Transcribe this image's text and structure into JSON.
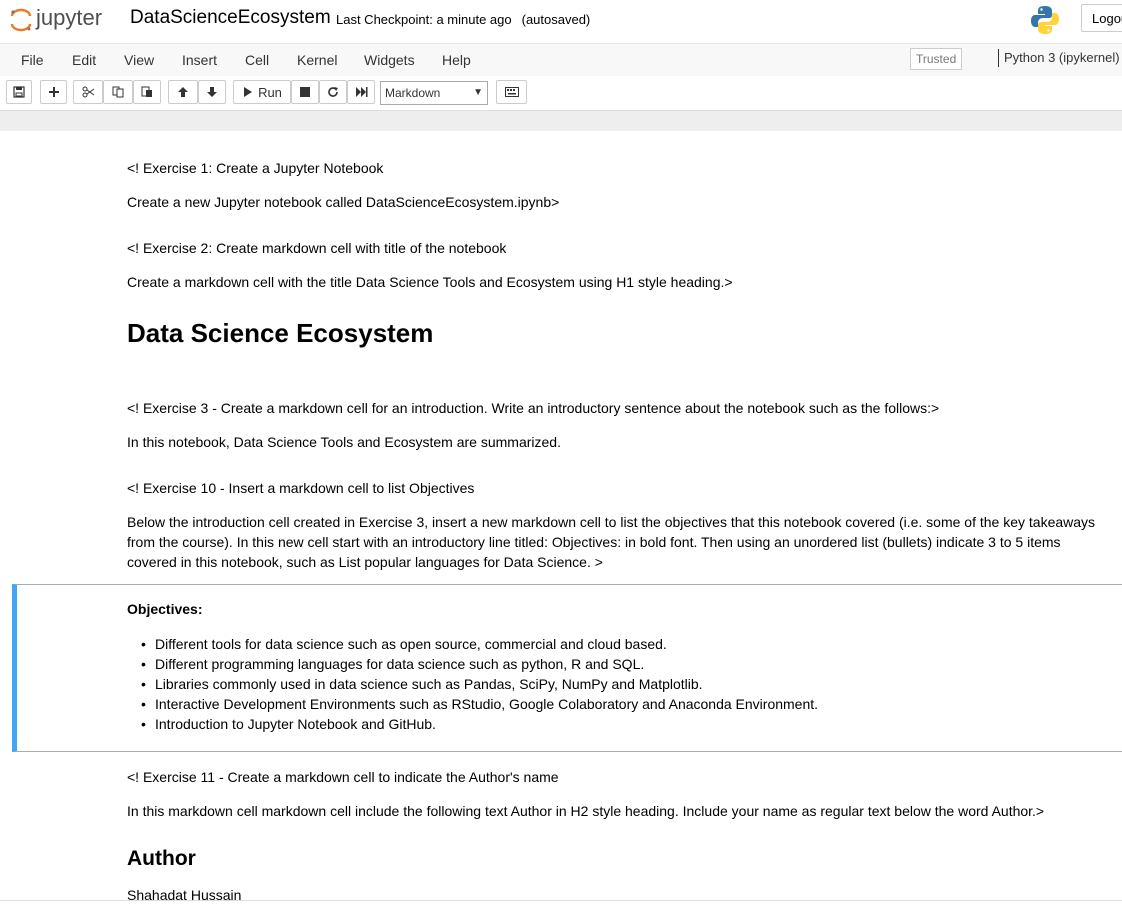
{
  "header": {
    "logo_text": "jupyter",
    "notebook_name": "DataScienceEcosystem",
    "checkpoint": "Last Checkpoint: a minute ago",
    "autosave": "(autosaved)",
    "logout": "Logout"
  },
  "menu": {
    "items": [
      "File",
      "Edit",
      "View",
      "Insert",
      "Cell",
      "Kernel",
      "Widgets",
      "Help"
    ],
    "trusted": "Trusted",
    "kernel": "Python 3 (ipykernel)"
  },
  "toolbar": {
    "run_label": "Run",
    "cell_type": "Markdown",
    "icons": [
      "save-icon",
      "plus-icon",
      "cut-icon",
      "copy-icon",
      "paste-icon",
      "arrow-up-icon",
      "arrow-down-icon",
      "play-icon",
      "stop-icon",
      "restart-icon",
      "fast-forward-icon",
      "keyboard-icon"
    ]
  },
  "cells": {
    "ex1_title": "<! Exercise 1: Create a Jupyter Notebook",
    "ex1_body": "Create a new Jupyter notebook called DataScienceEcosystem.ipynb>",
    "ex2_title": "<! Exercise 2: Create markdown cell with title of the notebook",
    "ex2_body": "Create a markdown cell with the title Data Science Tools and Ecosystem using H1 style heading.>",
    "h1": "Data Science Ecosystem",
    "ex3_title": "<! Exercise 3 - Create a markdown cell for an introduction. Write an introductory sentence about the notebook such as the follows:>",
    "ex3_body": "In this notebook, Data Science Tools and Ecosystem are summarized.",
    "ex10_title": "<! Exercise 10 - Insert a markdown cell to list Objectives",
    "ex10_body": "Below the introduction cell created in Exercise 3, insert a new markdown cell to list the objectives that this notebook covered (i.e. some of the key takeaways from the course). In this new cell start with an introductory line titled: Objectives: in bold font. Then using an unordered list (bullets) indicate 3 to 5 items covered in this notebook, such as List popular languages for Data Science. >",
    "objectives_title": "Objectives:",
    "objectives": [
      "Different tools for data science such as open source, commercial and cloud based.",
      "Different programming languages for data science such as python, R and SQL.",
      "Libraries commonly used in data science such as Pandas, SciPy, NumPy and Matplotlib.",
      "Interactive Development Environments such as RStudio, Google Colaboratory and Anaconda Environment.",
      "Introduction to Jupyter Notebook and GitHub."
    ],
    "ex11_title": "<! Exercise 11 - Create a markdown cell to indicate the Author's name",
    "ex11_body": "In this markdown cell markdown cell include the following text Author in H2 style heading. Include your name as regular text below the word Author.>",
    "h2": "Author",
    "author_name": "Shahadat Hussain"
  },
  "colors": {
    "accent": "#42a5f5",
    "jupyter_orange": "#f37726"
  }
}
